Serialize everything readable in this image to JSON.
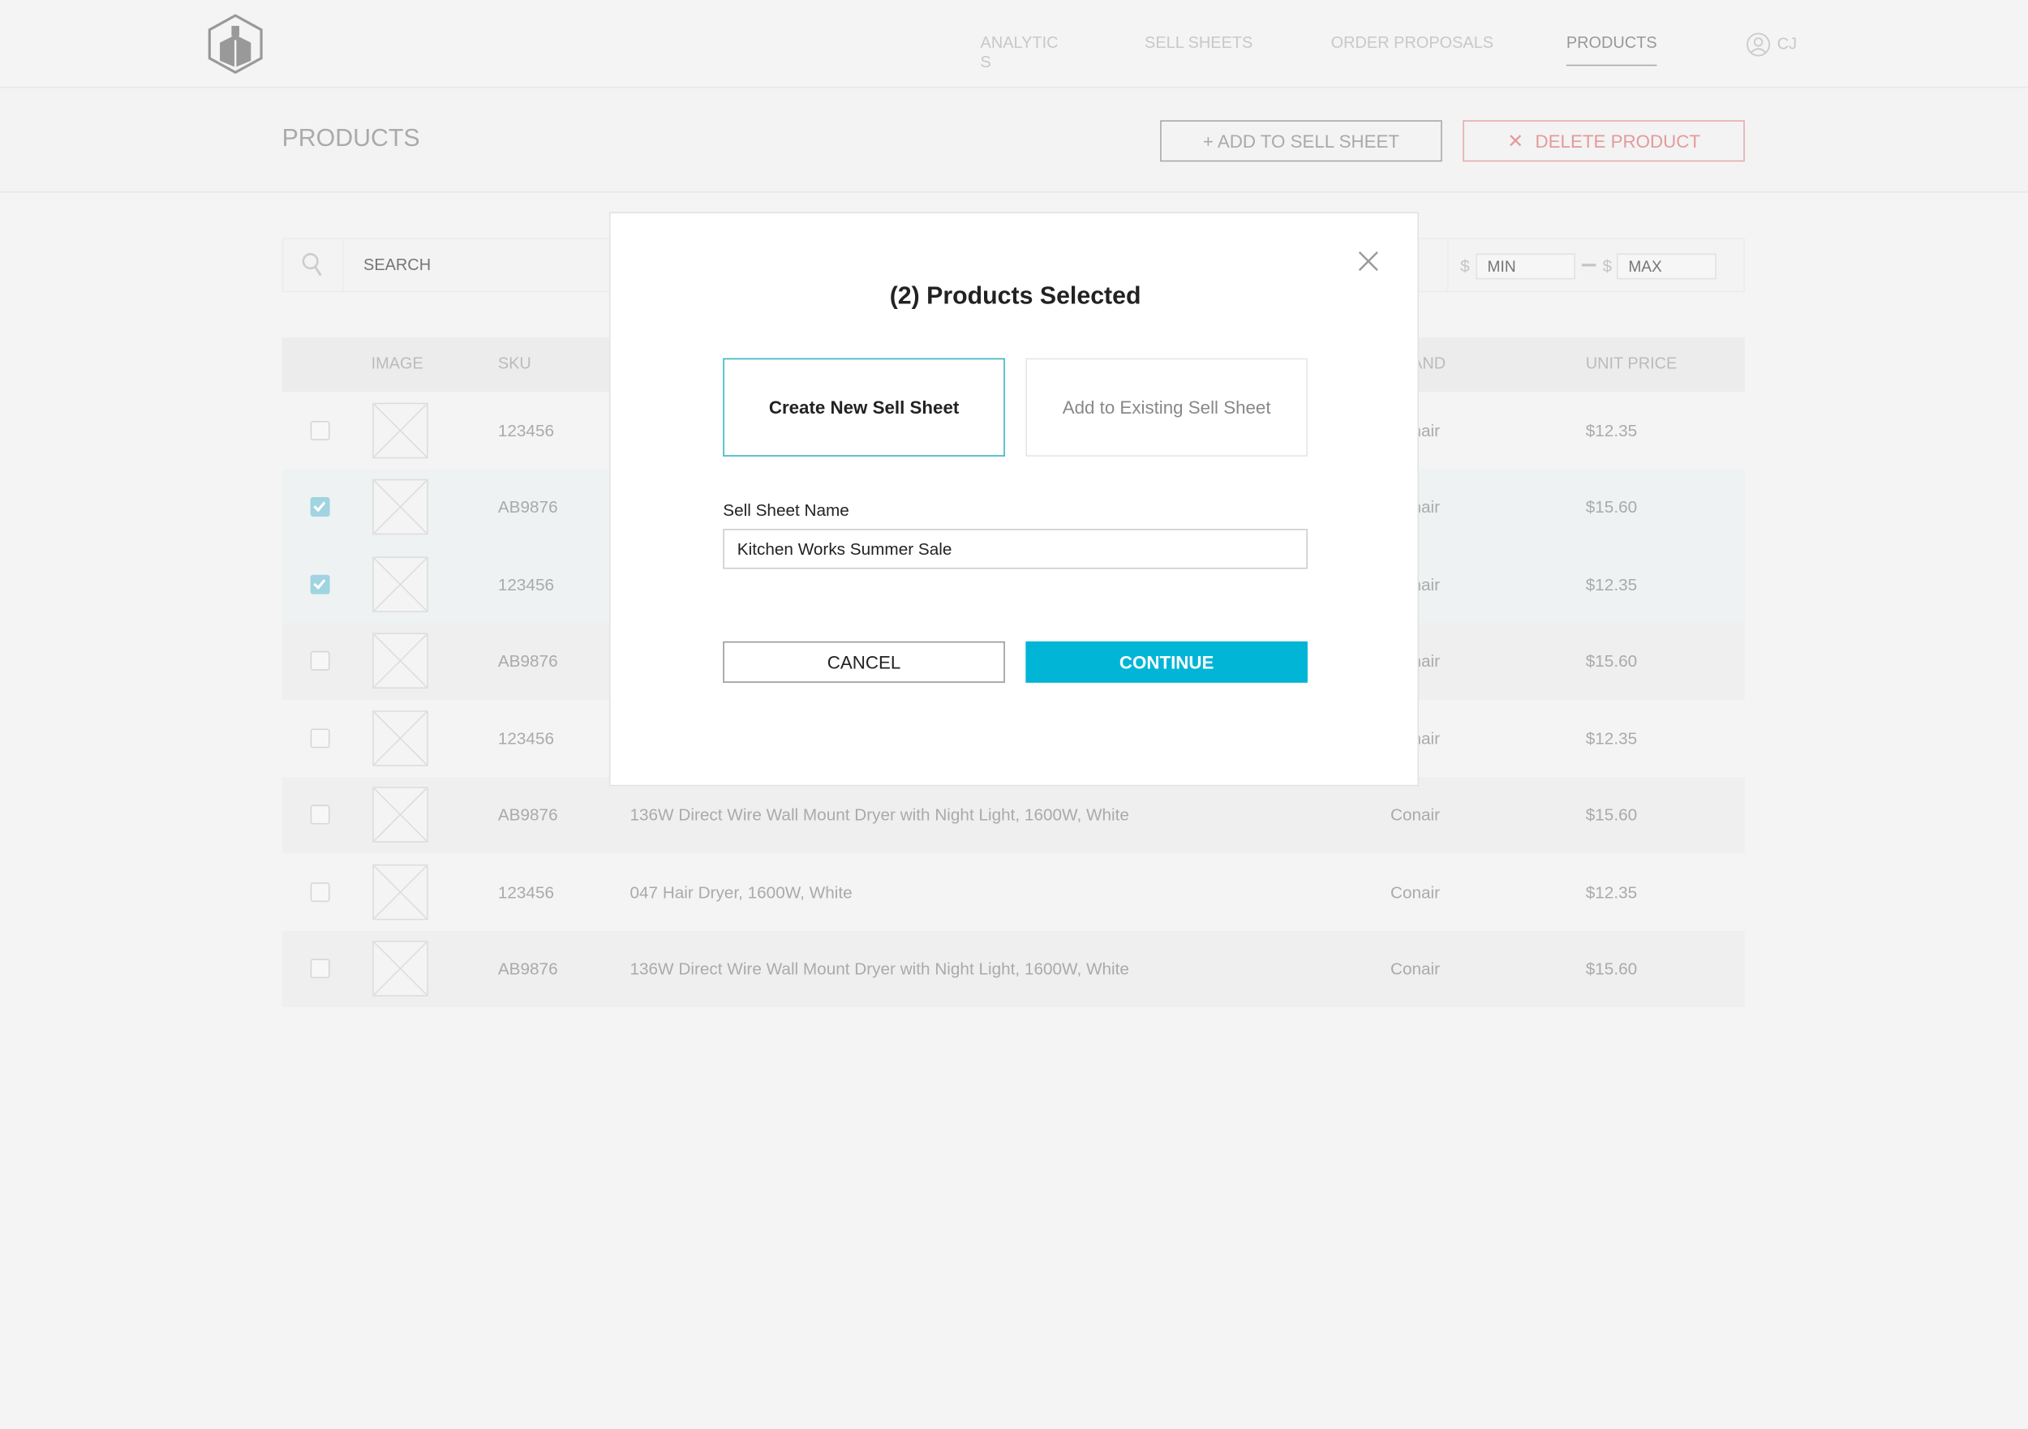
{
  "nav": {
    "items": [
      {
        "label": "ANALYTIC",
        "label_wrap": "S"
      },
      {
        "label": "SELL SHEETS"
      },
      {
        "label": "ORDER PROPOSALS"
      },
      {
        "label": "PRODUCTS",
        "active": true
      }
    ],
    "user_initials": "CJ",
    "logo_icon": "box-hexagon-logo",
    "user_icon": "user-circle-icon"
  },
  "header": {
    "title": "PRODUCTS",
    "add_button": "+ ADD TO SELL SHEET",
    "delete_button": "DELETE PRODUCT",
    "delete_color": "#e49a9a"
  },
  "filters": {
    "search_placeholder": "SEARCH",
    "currency": "$",
    "min_placeholder": "MIN",
    "max_placeholder": "MAX"
  },
  "table": {
    "columns": {
      "image": "IMAGE",
      "sku": "SKU",
      "brand": "BRAND",
      "price": "UNIT PRICE"
    },
    "rows": [
      {
        "checked": false,
        "sku": "123456",
        "description": "",
        "brand": "Conair",
        "price": "$12.35"
      },
      {
        "checked": true,
        "sku": "AB9876",
        "description": "",
        "brand": "Conair",
        "price": "$15.60"
      },
      {
        "checked": true,
        "sku": "123456",
        "description": "",
        "brand": "Conair",
        "price": "$12.35"
      },
      {
        "checked": false,
        "sku": "AB9876",
        "description": "",
        "brand": "Conair",
        "price": "$15.60"
      },
      {
        "checked": false,
        "sku": "123456",
        "description": "",
        "brand": "Conair",
        "price": "$12.35"
      },
      {
        "checked": false,
        "sku": "AB9876",
        "description": "136W Direct Wire Wall Mount Dryer with Night Light, 1600W, White",
        "brand": "Conair",
        "price": "$15.60"
      },
      {
        "checked": false,
        "sku": "123456",
        "description": "047 Hair Dryer, 1600W, White",
        "brand": "Conair",
        "price": "$12.35"
      },
      {
        "checked": false,
        "sku": "AB9876",
        "description": "136W Direct Wire Wall Mount Dryer with Night Light, 1600W, White",
        "brand": "Conair",
        "price": "$15.60"
      }
    ]
  },
  "modal": {
    "title": "(2) Products Selected",
    "option_new": "Create New Sell Sheet",
    "option_existing": "Add to Existing Sell Sheet",
    "field_label": "Sell Sheet Name",
    "field_value": "Kitchen Works Summer Sale",
    "cancel": "CANCEL",
    "continue": "CONTINUE",
    "accent": "#00b5d6"
  }
}
